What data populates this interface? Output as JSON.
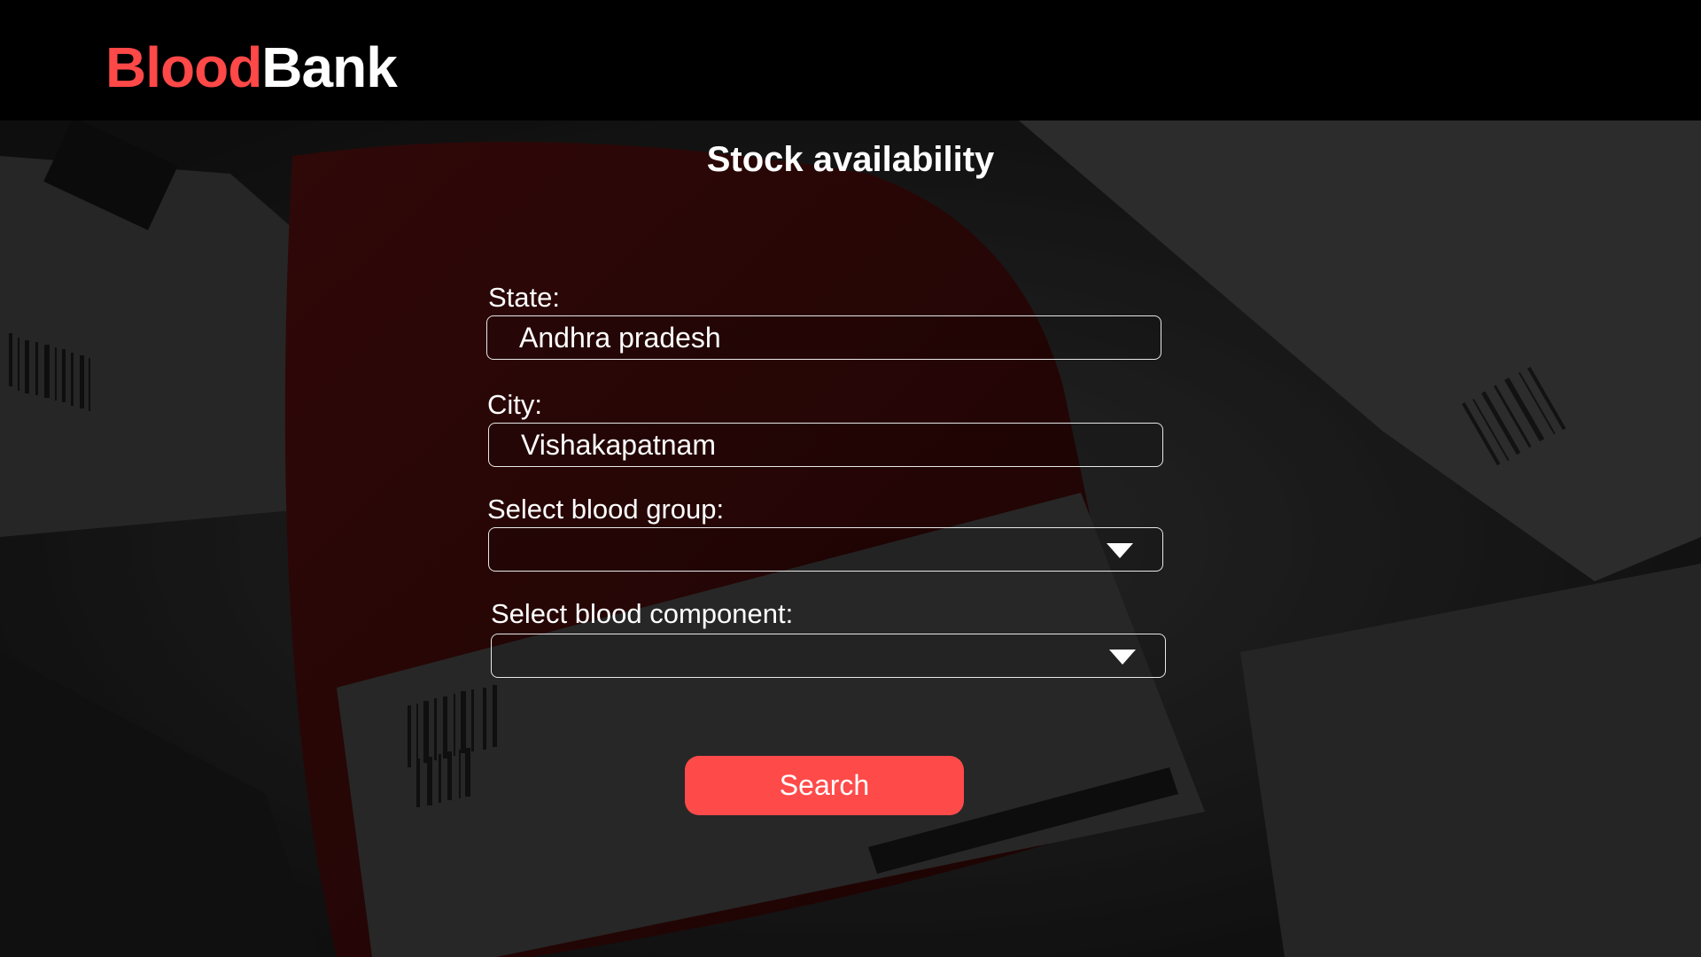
{
  "header": {
    "logo_part1": "Blood",
    "logo_part2": "Bank",
    "brand_color": "#ff4848"
  },
  "page": {
    "title": "Stock availability"
  },
  "form": {
    "state_label": "State:",
    "state_value": "Andhra pradesh",
    "city_label": "City:",
    "city_value": "Vishakapatnam",
    "blood_group_label": "Select blood group:",
    "blood_group_value": "",
    "blood_component_label": "Select blood component:",
    "blood_component_value": "",
    "dropdown_icon": "chevron-down-icon",
    "search_label": "Search",
    "search_color": "#ff4a4a"
  }
}
